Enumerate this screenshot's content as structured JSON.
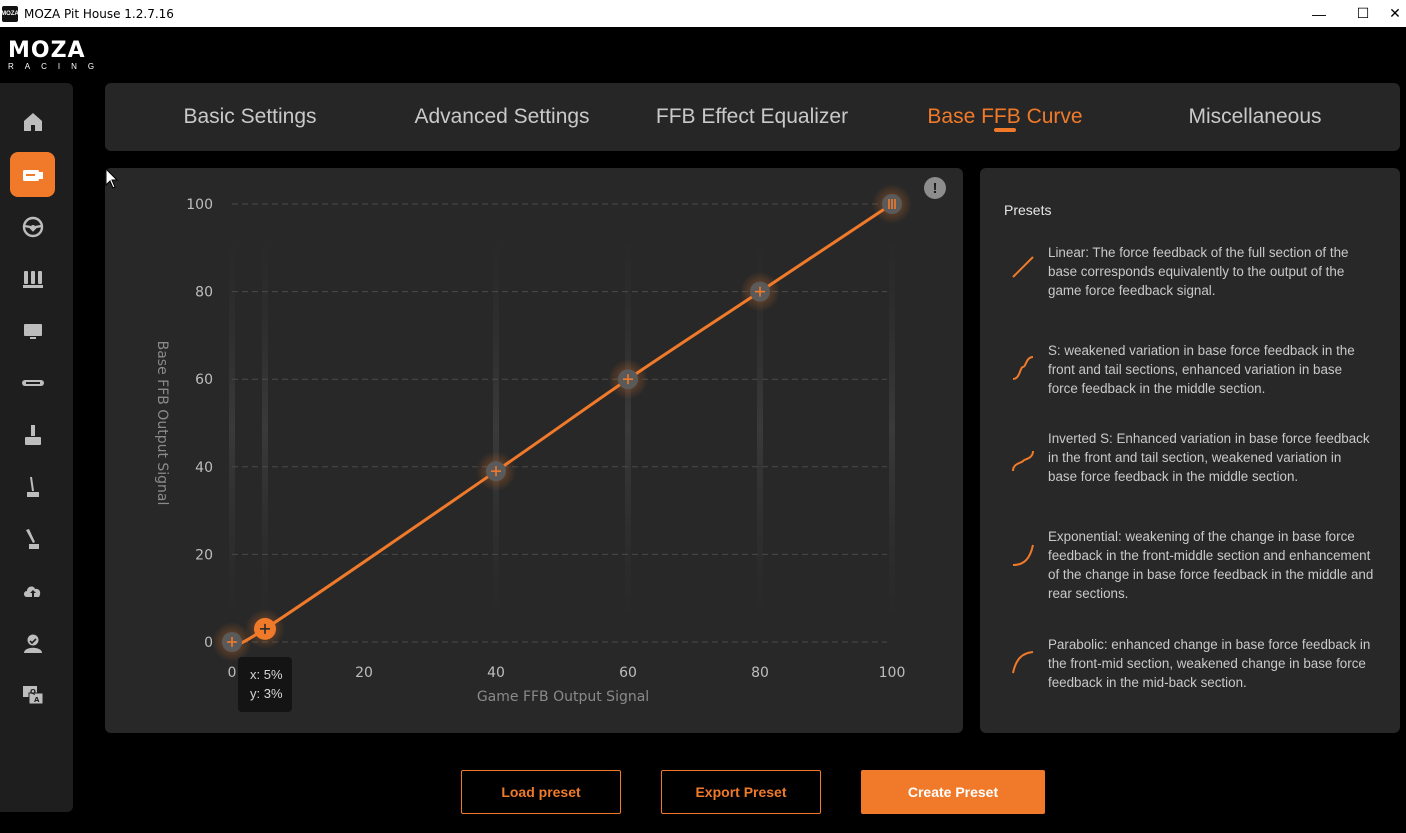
{
  "window": {
    "app_title": "MOZA Pit House 1.2.7.16",
    "app_icon_text": "MOZA",
    "minimize_label": "—",
    "maximize_label": "☐",
    "close_label": "✕"
  },
  "logo": {
    "brand": "MOZA",
    "sub": "RACING"
  },
  "sidebar": {
    "items": [
      {
        "name": "home-icon",
        "active": false
      },
      {
        "name": "wheelbase-icon",
        "active": true
      },
      {
        "name": "steering-wheel-icon",
        "active": false
      },
      {
        "name": "pedals-icon",
        "active": false
      },
      {
        "name": "dashboard-icon",
        "active": false
      },
      {
        "name": "handbrake-bar-icon",
        "active": false
      },
      {
        "name": "joystick-icon",
        "active": false
      },
      {
        "name": "shifter-icon",
        "active": false
      },
      {
        "name": "sequential-shifter-icon",
        "active": false
      },
      {
        "name": "cloud-upload-icon",
        "active": false
      },
      {
        "name": "user-icon",
        "active": false
      },
      {
        "name": "qa-help-icon",
        "active": false
      }
    ]
  },
  "tabs": [
    {
      "label": "Basic Settings",
      "active": false
    },
    {
      "label": "Advanced Settings",
      "active": false
    },
    {
      "label": "FFB Effect Equalizer",
      "active": false
    },
    {
      "label": "Base FFB Curve",
      "active": true
    },
    {
      "label": "Miscellaneous",
      "active": false
    }
  ],
  "chart_data": {
    "type": "line",
    "xlabel": "Game FFB Output Signal",
    "ylabel": "Base FFB Output Signal",
    "x_ticks": [
      "0",
      "20",
      "40",
      "60",
      "80",
      "100"
    ],
    "y_ticks": [
      "0",
      "20",
      "40",
      "60",
      "80",
      "100"
    ],
    "xlim": [
      0,
      100
    ],
    "ylim": [
      0,
      100
    ],
    "x": [
      0,
      5,
      40,
      60,
      80,
      100
    ],
    "y": [
      0,
      3,
      39,
      60,
      80,
      100
    ],
    "selected_point": 1,
    "line_color": "#f07a2a",
    "grid": true
  },
  "info_label": "!",
  "tooltip": {
    "x_text": "x: 5%",
    "y_text": "y: 3%"
  },
  "presets": {
    "title": "Presets",
    "items": [
      {
        "kind": "linear",
        "text": "Linear: The force feedback of the full section of the base corresponds equivalently to the output of the game force feedback signal."
      },
      {
        "kind": "s",
        "text": "S: weakened variation in base force feedback in the front and tail sections, enhanced variation in base force feedback in the middle section."
      },
      {
        "kind": "inverted-s",
        "text": "Inverted S: Enhanced variation in base force feedback in the front and tail section, weakened variation in base force feedback in the middle section."
      },
      {
        "kind": "exponential",
        "text": "Exponential: weakening of the change in base force feedback in the front-middle section and enhancement of the change in base force feedback in the middle and rear sections."
      },
      {
        "kind": "parabolic",
        "text": "Parabolic: enhanced change in base force feedback in the front-mid section, weakened change in base force feedback in the mid-back section."
      }
    ]
  },
  "buttons": {
    "load": "Load preset",
    "export": "Export Preset",
    "create": "Create Preset"
  },
  "colors": {
    "accent": "#f07a2a",
    "panel": "#282828",
    "background": "#000000"
  }
}
